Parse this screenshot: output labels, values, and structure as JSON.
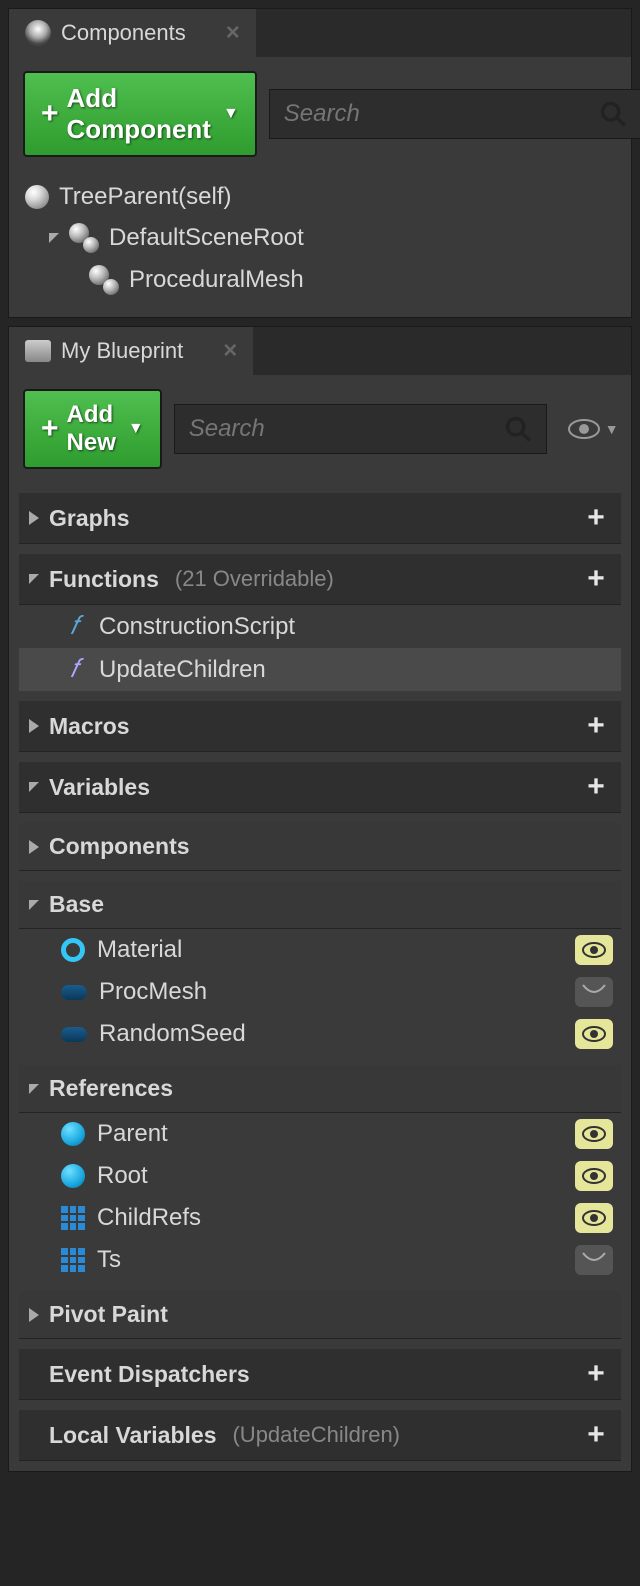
{
  "components_panel": {
    "tab_title": "Components",
    "add_button": "Add Component",
    "search_placeholder": "Search",
    "tree": {
      "self": "TreeParent(self)",
      "root": "DefaultSceneRoot",
      "child": "ProceduralMesh"
    }
  },
  "blueprint_panel": {
    "tab_title": "My Blueprint",
    "add_button": "Add New",
    "search_placeholder": "Search",
    "sections": {
      "graphs": {
        "title": "Graphs"
      },
      "functions": {
        "title": "Functions",
        "note": "(21 Overridable)",
        "items": [
          {
            "name": "ConstructionScript",
            "kind": "construct"
          },
          {
            "name": "UpdateChildren",
            "kind": "func"
          }
        ]
      },
      "macros": {
        "title": "Macros"
      },
      "variables": {
        "title": "Variables",
        "groups": {
          "components": {
            "title": "Components"
          },
          "base": {
            "title": "Base",
            "items": [
              {
                "name": "Material",
                "icon": "circle-open",
                "public": true
              },
              {
                "name": "ProcMesh",
                "icon": "pill",
                "public": false
              },
              {
                "name": "RandomSeed",
                "icon": "pill",
                "public": true
              }
            ]
          },
          "references": {
            "title": "References",
            "items": [
              {
                "name": "Parent",
                "icon": "circle-fill",
                "public": true
              },
              {
                "name": "Root",
                "icon": "circle-fill",
                "public": true
              },
              {
                "name": "ChildRefs",
                "icon": "grid",
                "public": true
              },
              {
                "name": "Ts",
                "icon": "grid",
                "public": false
              }
            ]
          },
          "pivot_paint": {
            "title": "Pivot Paint"
          }
        }
      },
      "event_dispatchers": {
        "title": "Event Dispatchers"
      },
      "local_variables": {
        "title": "Local Variables",
        "note": "(UpdateChildren)"
      }
    }
  }
}
